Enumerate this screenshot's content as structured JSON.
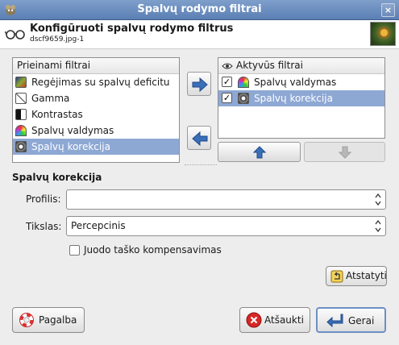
{
  "window": {
    "title": "Spalvų rodymo filtrai",
    "close_glyph": "×"
  },
  "header": {
    "title": "Konfigūruoti spalvų rodymo filtrus",
    "subtitle": "dscf9659.jpg-1"
  },
  "available": {
    "heading": "Prieinami filtrai",
    "items": [
      {
        "label": "Regėjimas su spalvų deficitu",
        "icon": "color-deficient-icon"
      },
      {
        "label": "Gamma",
        "icon": "gamma-icon"
      },
      {
        "label": "Kontrastas",
        "icon": "contrast-icon"
      },
      {
        "label": "Spalvų valdymas",
        "icon": "color-management-icon"
      },
      {
        "label": "Spalvų korekcija",
        "icon": "proof-icon",
        "selected": true
      }
    ]
  },
  "active": {
    "heading": "Aktyvūs filtrai",
    "items": [
      {
        "label": "Spalvų valdymas",
        "checked": true,
        "icon": "color-management-icon"
      },
      {
        "label": "Spalvų korekcija",
        "checked": true,
        "icon": "proof-icon",
        "selected": true
      }
    ]
  },
  "section": {
    "title": "Spalvų korekcija",
    "profile_label": "Profilis:",
    "profile_value": "",
    "intent_label": "Tikslas:",
    "intent_value": "Percepcinis",
    "bpc_label": "Juodo taško kompensavimas",
    "reset_label": "Atstatyti"
  },
  "buttons": {
    "help": "Pagalba",
    "cancel": "Atšaukti",
    "ok": "Gerai"
  },
  "colors": {
    "accent": "#8ea8d4",
    "titlebar": "#6a8cbf",
    "arrow_blue": "#3a6fb8"
  }
}
